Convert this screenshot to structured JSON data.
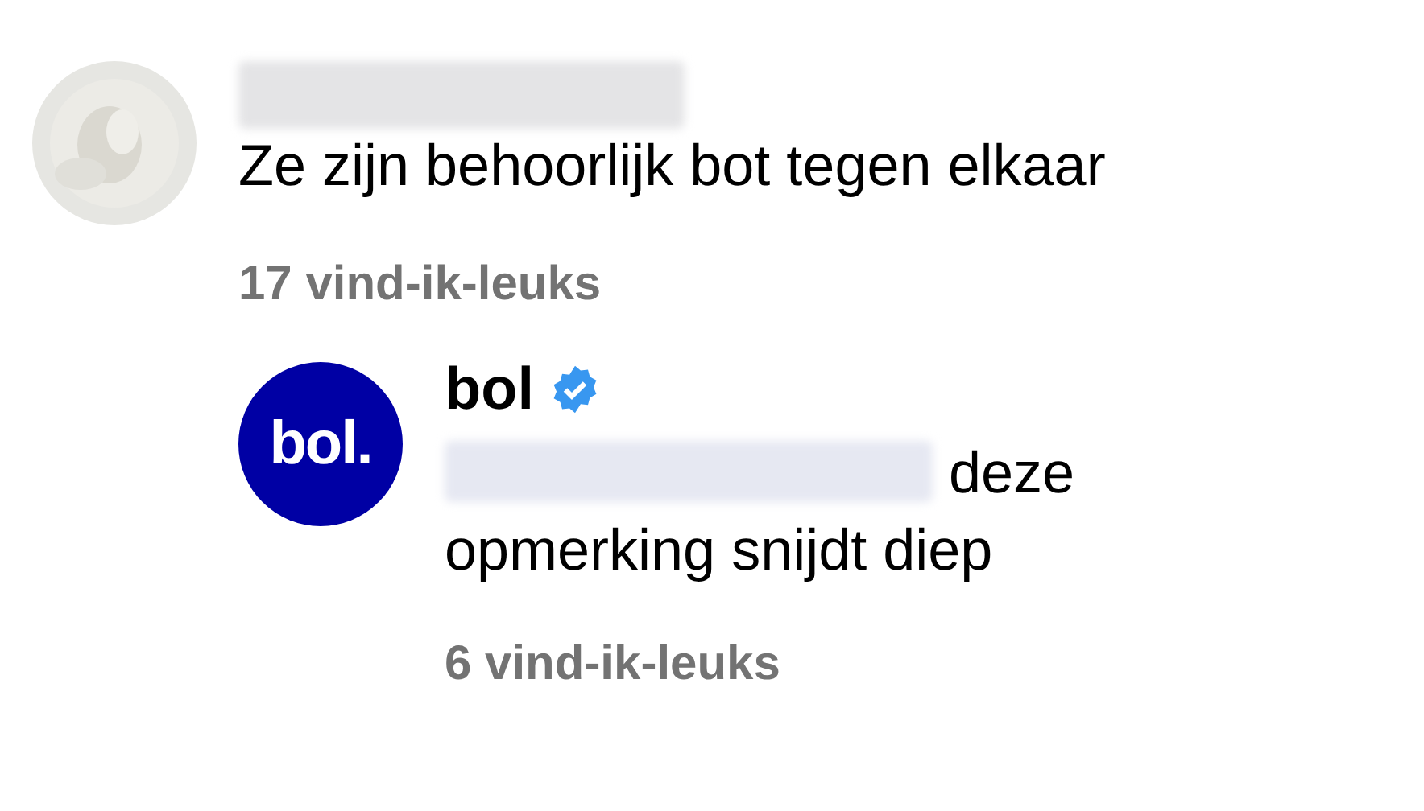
{
  "comment": {
    "author": {
      "redacted": true
    },
    "text": "Ze zijn behoorlijk bot tegen elkaar",
    "likes": "17 vind-ik-leuks",
    "reply": {
      "author": "bol",
      "verified": true,
      "logo_text": "bol.",
      "mention": {
        "redacted": true
      },
      "text": "deze opmerking snijdt diep",
      "likes": "6 vind-ik-leuks"
    }
  }
}
